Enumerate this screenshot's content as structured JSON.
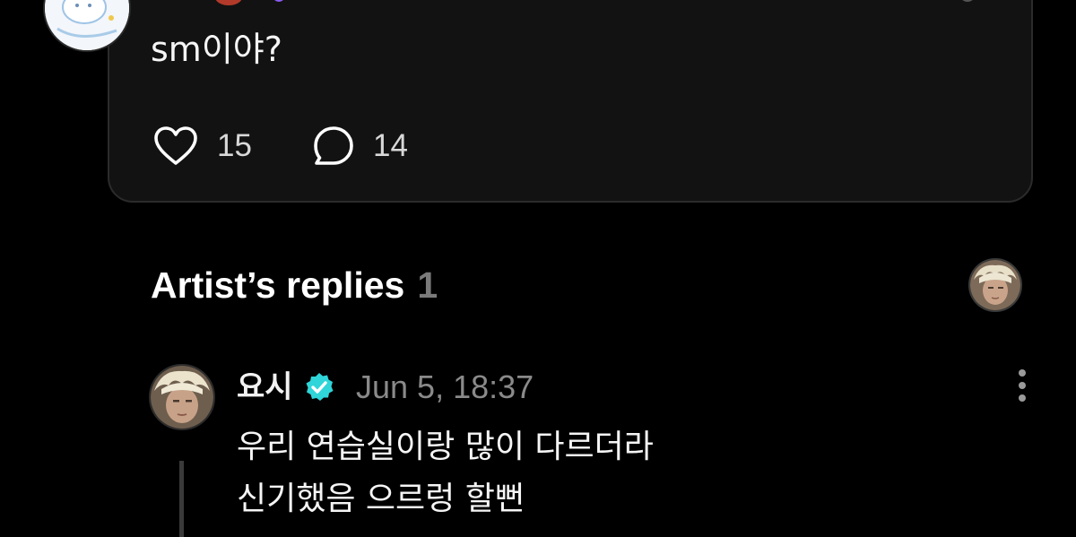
{
  "post": {
    "text": "sm이야?",
    "like_count": "15",
    "comment_count": "14"
  },
  "artist_replies": {
    "title": "Artist’s replies",
    "count": "1"
  },
  "reply": {
    "author": "요시",
    "timestamp": "Jun 5, 18:37",
    "lines": [
      "우리 연습실이랑 많이 다르더라",
      "신기했음 으르렁 할뻔"
    ]
  },
  "icons": {
    "like": "heart-icon",
    "comment": "comment-bubble-icon",
    "verified": "verified-badge-icon",
    "more": "more-vertical-icon"
  },
  "colors": {
    "background": "#000000",
    "card": "#121212",
    "verified": "#2fd5d9",
    "muted_text": "#8a8a8a"
  }
}
